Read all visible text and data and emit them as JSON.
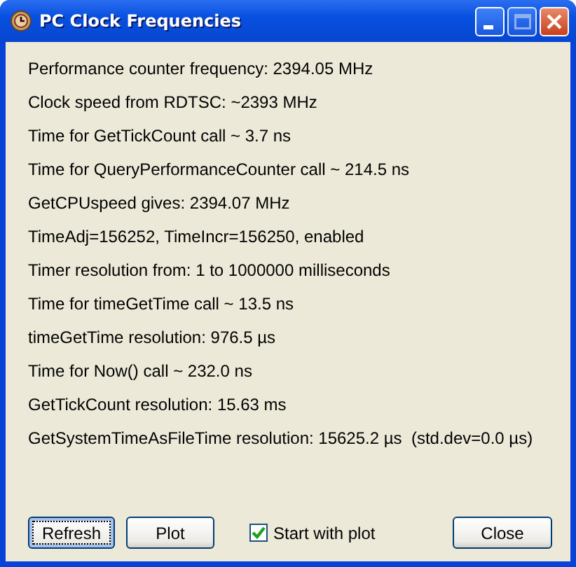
{
  "window": {
    "title": "PC Clock Frequencies"
  },
  "lines": [
    "Performance counter frequency: 2394.05 MHz",
    "Clock speed from RDTSC: ~2393 MHz",
    "Time for GetTickCount call ~ 3.7 ns",
    "Time for QueryPerformanceCounter call ~ 214.5 ns",
    "GetCPUspeed gives: 2394.07 MHz",
    "TimeAdj=156252, TimeIncr=156250, enabled",
    "Timer resolution from: 1 to 1000000 milliseconds",
    "Time for timeGetTime call ~ 13.5 ns",
    "timeGetTime resolution: 976.5 µs",
    "Time for Now() call ~ 232.0 ns",
    "GetTickCount resolution: 15.63 ms",
    "GetSystemTimeAsFileTime resolution: 15625.2 µs  (std.dev=0.0 µs)"
  ],
  "buttons": [
    {
      "label": "Refresh",
      "focused": true
    },
    {
      "label": "Plot",
      "focused": false
    }
  ],
  "checkbox": {
    "label": "Start with plot",
    "checked": true
  },
  "close_button": {
    "label": "Close"
  }
}
